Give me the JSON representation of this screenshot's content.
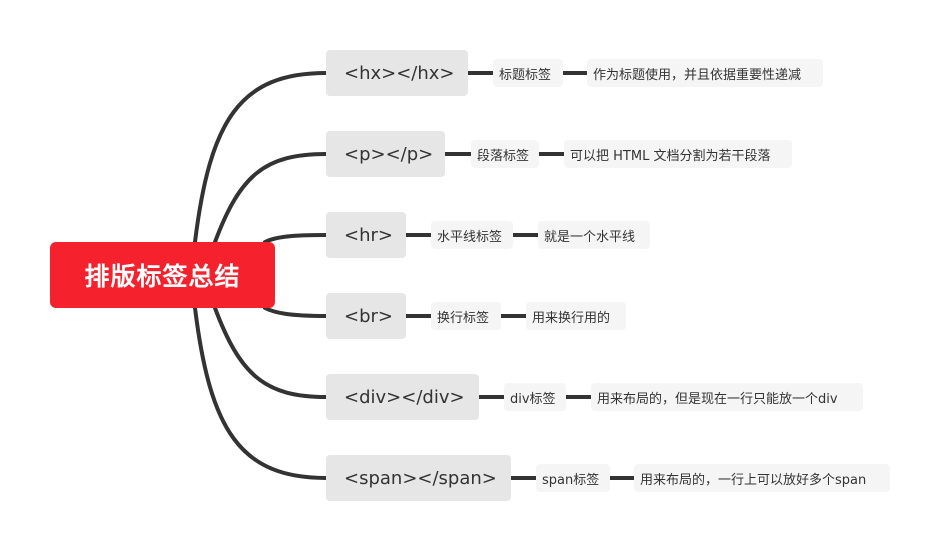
{
  "root": {
    "label": "排版标签总结"
  },
  "branches": [
    {
      "tag": "<hx></hx>",
      "name": "标题标签",
      "desc": "作为标题使用，并且依据重要性递减"
    },
    {
      "tag": "<p></p>",
      "name": "段落标签",
      "desc": "可以把 HTML 文档分割为若干段落"
    },
    {
      "tag": "<hr>",
      "name": "水平线标签",
      "desc": "就是一个水平线"
    },
    {
      "tag": "<br>",
      "name": "换行标签",
      "desc": "用来换行用的"
    },
    {
      "tag": "<div></div>",
      "name": "div标签",
      "desc": "用来布局的，但是现在一行只能放一个div"
    },
    {
      "tag": "<span></span>",
      "name": "span标签",
      "desc": "用来布局的，一行上可以放好多个span"
    }
  ],
  "colors": {
    "root_bg": "#f5222d",
    "level1_bg": "#e6e6e6",
    "leaf_bg": "#f5f5f5",
    "connector": "#333333"
  }
}
